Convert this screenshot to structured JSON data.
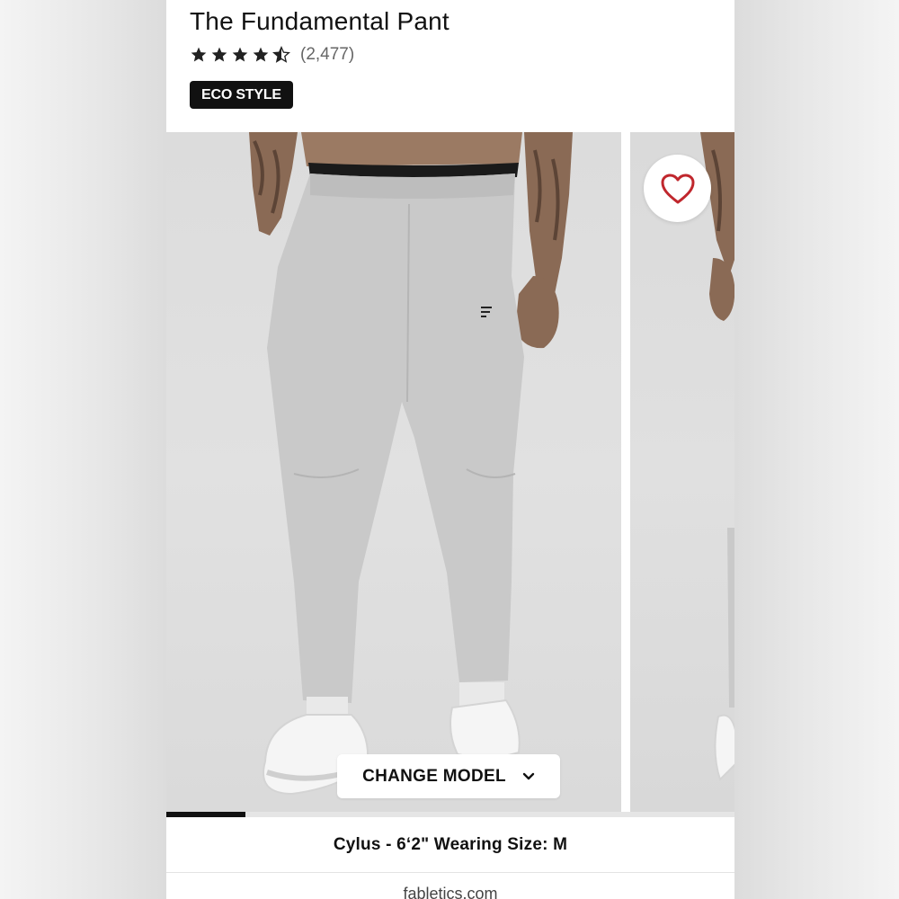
{
  "product": {
    "title": "The Fundamental Pant",
    "rating": 4.5,
    "rating_max": 5,
    "review_count": "(2,477)",
    "badge": "ECO STYLE"
  },
  "gallery": {
    "favorite_icon": "heart-icon",
    "change_model_label": "CHANGE MODEL",
    "change_model_icon": "chevron-down-icon",
    "image_progress": 0.14,
    "image_index": 1
  },
  "model_info": "Cylus - 6‘2\" Wearing Size: M",
  "site": {
    "domain": "fabletics.com"
  },
  "colors": {
    "accent": "#111111",
    "heart": "#c0272d",
    "star": "#222222",
    "pant": "#c9c9c9"
  }
}
